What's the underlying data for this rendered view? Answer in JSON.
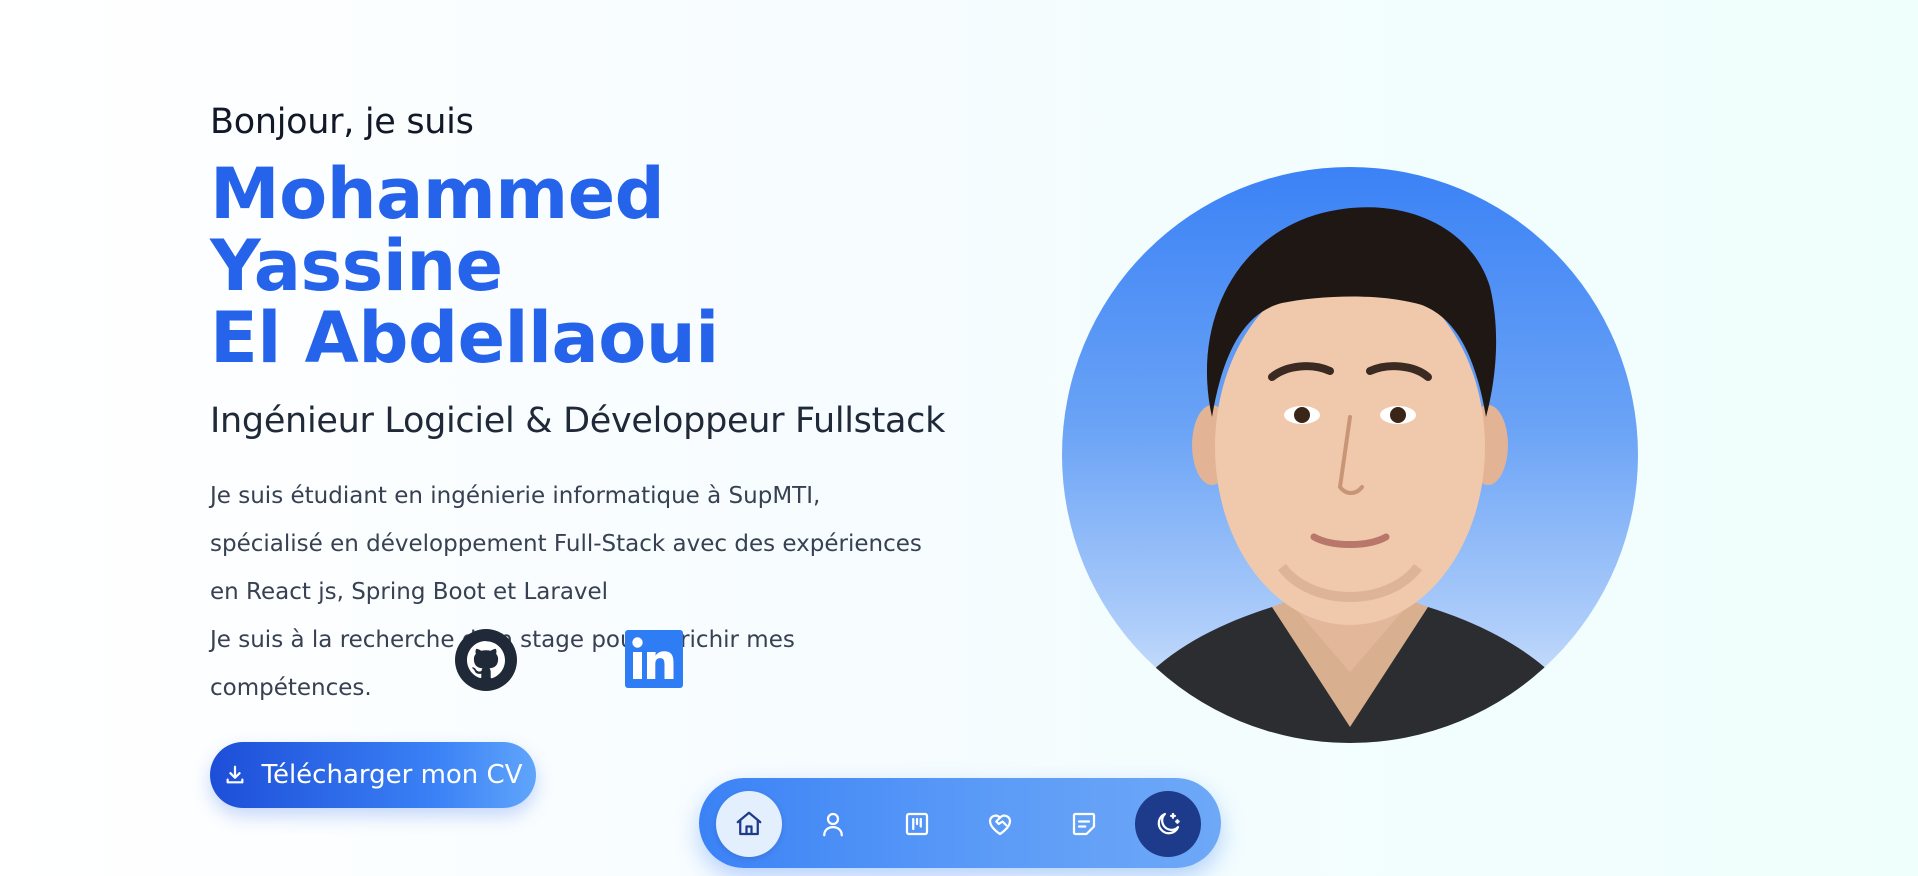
{
  "hero": {
    "greeting": "Bonjour, je suis",
    "name_line1": "Mohammed Yassine",
    "name_line2": "El Abdellaoui",
    "role": "Ingénieur Logiciel & Développeur Fullstack",
    "bio_paragraph1": "Je suis étudiant en ingénierie informatique à SupMTI, spécialisé en développement Full-Stack avec des expériences en React js, Spring Boot et Laravel",
    "bio_paragraph2": "Je suis à la recherche d’un stage pour enrichir mes compétences."
  },
  "socials": [
    {
      "icon": "github-icon"
    },
    {
      "icon": "linkedin-icon"
    }
  ],
  "cv_button": {
    "label": "Télécharger mon CV",
    "icon": "download-icon"
  },
  "profile_photo": {
    "icon": "profile-photo"
  },
  "navbar": {
    "items": [
      {
        "icon": "home-icon",
        "active": true
      },
      {
        "icon": "user-icon",
        "active": false
      },
      {
        "icon": "kanban-icon",
        "active": false
      },
      {
        "icon": "heart-handshake-icon",
        "active": false
      },
      {
        "icon": "message-square-icon",
        "active": false
      },
      {
        "icon": "moon-stars-icon",
        "active": false
      }
    ]
  },
  "colors": {
    "accent": "#2563eb",
    "nav_gradient_start": "#3b82f6",
    "theme_toggle_bg": "#1e3a8a",
    "linkedin_blue": "#2f7df5"
  }
}
